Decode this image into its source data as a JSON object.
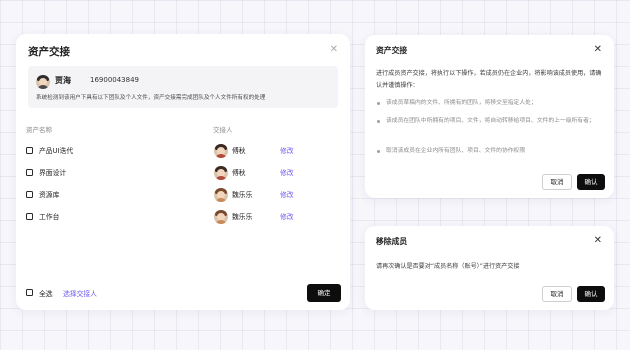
{
  "transfer_dialog": {
    "title": "资产交接",
    "user": {
      "name": "贾海",
      "phone": "16900043849",
      "description": "系统检测到该用户下具有以下团队及个人文件，资产交接需完成团队及个人文件所有权的处理"
    },
    "columns": {
      "asset": "资产名称",
      "receiver": "交接人"
    },
    "rows": [
      {
        "asset": "产品UI迭代",
        "receiver": "傅秋",
        "action": "修改",
        "avatar_hair": "#3a2a22",
        "avatar_body": "#b24a3a"
      },
      {
        "asset": "界面设计",
        "receiver": "傅秋",
        "action": "修改",
        "avatar_hair": "#3a2a22",
        "avatar_body": "#b24a3a"
      },
      {
        "asset": "资源库",
        "receiver": "魏乐乐",
        "action": "修改",
        "avatar_hair": "#7a4a2e",
        "avatar_body": "#c98a5a"
      },
      {
        "asset": "工作台",
        "receiver": "魏乐乐",
        "action": "修改",
        "avatar_hair": "#7a4a2e",
        "avatar_body": "#c98a5a"
      }
    ],
    "footer": {
      "select_all": "全选",
      "choose_receiver": "选择交接人",
      "confirm": "确定"
    }
  },
  "confirm_transfer_dialog": {
    "title": "资产交接",
    "lead": "进行成员资产交接，将执行以下操作，若成员仍在企业内，将影响该成员使用，请确认并谨慎操作：",
    "bullets": [
      "该成员草稿内的文件、所拥有的团队，将移交至指定人处；",
      "该成员在团队中所拥有的项目、文件，将自动转移给项目、文件的上一级所有者；",
      "取消该成员在企业内所有团队、项目、文件的协作权限"
    ],
    "cancel": "取消",
    "confirm": "确认"
  },
  "remove_member_dialog": {
    "title": "移除成员",
    "text": "请再次确认是否要对“成员名称（账号）”进行资产交接",
    "cancel": "取消",
    "confirm": "确认"
  },
  "colors": {
    "accent_link": "#6d5cf0",
    "primary_button": "#0d0d0d"
  }
}
